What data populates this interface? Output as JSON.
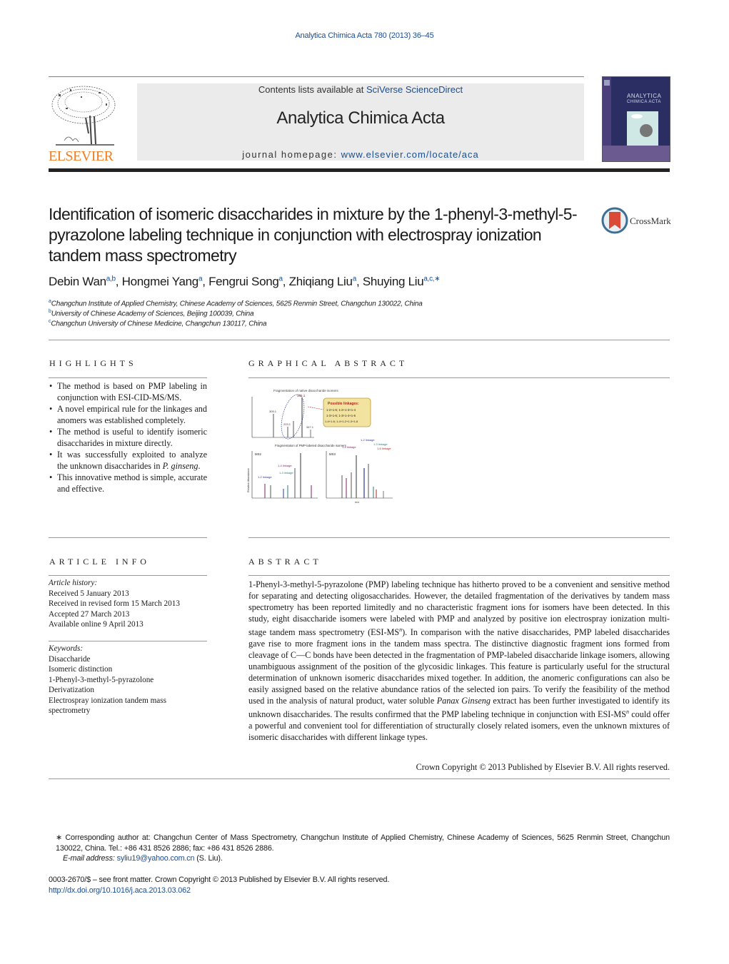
{
  "header": {
    "journal_reference": "Analytica Chimica Acta 780 (2013) 36–45",
    "contents_prefix": "Contents lists available at ",
    "contents_link": "SciVerse ScienceDirect",
    "journal_title": "Analytica Chimica Acta",
    "homepage_prefix": "journal homepage: ",
    "homepage_link": "www.elsevier.com/locate/aca",
    "publisher_logo_text": "ELSEVIER",
    "cover_title_line1": "ANALYTICA",
    "cover_title_line2": "CHIMICA ACTA",
    "colors": {
      "publisher_orange": "#f07d23",
      "link_blue": "#1a4d8f",
      "cover_navy": "#2a2e63",
      "masthead_gray": "#ebebeb"
    }
  },
  "article": {
    "title": "Identification of isomeric disaccharides in mixture by the 1-phenyl-3-methyl-5-pyrazolone labeling technique in conjunction with electrospray ionization tandem mass spectrometry",
    "crossmark_label": "CrossMark",
    "authors": [
      {
        "name": "Debin Wan",
        "affil": "a,b"
      },
      {
        "name": "Hongmei Yang",
        "affil": "a"
      },
      {
        "name": "Fengrui Song",
        "affil": "a"
      },
      {
        "name": "Zhiqiang Liu",
        "affil": "a"
      },
      {
        "name": "Shuying Liu",
        "affil": "a,c,∗"
      }
    ],
    "affiliations": [
      {
        "key": "a",
        "text": "Changchun Institute of Applied Chemistry, Chinese Academy of Sciences, 5625 Renmin Street, Changchun 130022, China"
      },
      {
        "key": "b",
        "text": "University of Chinese Academy of Sciences, Beijing 100039, China"
      },
      {
        "key": "c",
        "text": "Changchun University of Chinese Medicine, Changchun 130117, China"
      }
    ]
  },
  "highlights": {
    "heading": "HIGHLIGHTS",
    "items": [
      "The method is based on PMP labeling in conjunction with ESI-CID-MS/MS.",
      "A novel empirical rule for the linkages and anomers was established completely.",
      "The method is useful to identify isomeric disaccharides in mixture directly.",
      "It was successfully exploited to analyze the unknown disaccharides in ",
      "This innovative method is simple, accurate and effective."
    ],
    "item4_italic": "P. ginseng",
    "item4_end": "."
  },
  "graphical_abstract": {
    "heading": "GRAPHICAL ABSTRACT",
    "top_panel_title": "Fragmentation of native disaccharide isomers",
    "callout_title": "Possible linkages:",
    "callout_lines": [
      "1-2+1-6;  1-2+1-3+1-4",
      "1-3+1-6;  1-3+1-4+1-6",
      "1-4+1-6;  1-4+1-2+1-3+1-6"
    ],
    "bottom_panel_title": "Fragmentation of PMP-labeled disaccharide isomers",
    "left_label": "MS2",
    "right_label": "MS3",
    "top_peak_labels": [
      "365.1",
      "305.1",
      "203.1",
      "347.1"
    ],
    "linkage_labels": {
      "l12": "1-2 linkage",
      "l13": "1-3 linkage",
      "l14": "1-4 linkage",
      "l16": "1-6 linkage"
    },
    "y_axis_label": "Relative Abundance",
    "x_axis_label": "m/z"
  },
  "article_info": {
    "heading": "ARTICLE INFO",
    "history_label": "Article history:",
    "history": [
      "Received 5 January 2013",
      "Received in revised form 15 March 2013",
      "Accepted 27 March 2013",
      "Available online 9 April 2013"
    ],
    "keywords_label": "Keywords:",
    "keywords": [
      "Disaccharide",
      "Isomeric distinction",
      "1-Phenyl-3-methyl-5-pyrazolone",
      "Derivatization",
      "Electrospray ionization tandem mass spectrometry"
    ]
  },
  "abstract": {
    "heading": "ABSTRACT",
    "part1": "1-Phenyl-3-methyl-5-pyrazolone (PMP) labeling technique has hitherto proved to be a convenient and sensitive method for separating and detecting oligosaccharides. However, the detailed fragmentation of the derivatives by tandem mass spectrometry has been reported limitedly and no characteristic fragment ions for isomers have been detected. In this study, eight disaccharide isomers were labeled with PMP and analyzed by positive ion electrospray ionization multi-stage tandem mass spectrometry (ESI-MS",
    "sup_n": "n",
    "part2": "). In comparison with the native disaccharides, PMP labeled disaccharides gave rise to more fragment ions in the tandem mass spectra. The distinctive diagnostic fragment ions formed from cleavage of C—C bonds have been detected in the fragmentation of PMP-labeled disaccharide linkage isomers, allowing unambiguous assignment of the position of the glycosidic linkages. This feature is particularly useful for the structural determination of unknown isomeric disaccharides mixed together. In addition, the anomeric configurations can also be easily assigned based on the relative abundance ratios of the selected ion pairs. To verify the feasibility of the method used in the analysis of natural product, water soluble ",
    "italic_species": "Panax Ginseng",
    "part3": " extract has been further investigated to identify its unknown disaccharides. The results confirmed that the PMP labeling technique in conjunction with ESI-MS",
    "part4": " could offer a powerful and convenient tool for differentiation of structurally closely related isomers, even the unknown mixtures of isomeric disaccharides with different linkage types.",
    "copyright": "Crown Copyright © 2013 Published by Elsevier B.V. All rights reserved."
  },
  "footnotes": {
    "corresponding": "∗ Corresponding author at: Changchun Center of Mass Spectrometry, Changchun Institute of Applied Chemistry, Chinese Academy of Sciences, 5625 Renmin Street, Changchun 130022, China. Tel.: +86 431 8526 2886; fax: +86 431 8526 2886.",
    "email_label": "E-mail address: ",
    "email": "syliu19@yahoo.com.cn",
    "email_suffix": " (S. Liu).",
    "front_matter": "0003-2670/$ – see front matter. Crown Copyright © 2013 Published by Elsevier B.V. All rights reserved.",
    "doi": "http://dx.doi.org/10.1016/j.aca.2013.03.062"
  }
}
